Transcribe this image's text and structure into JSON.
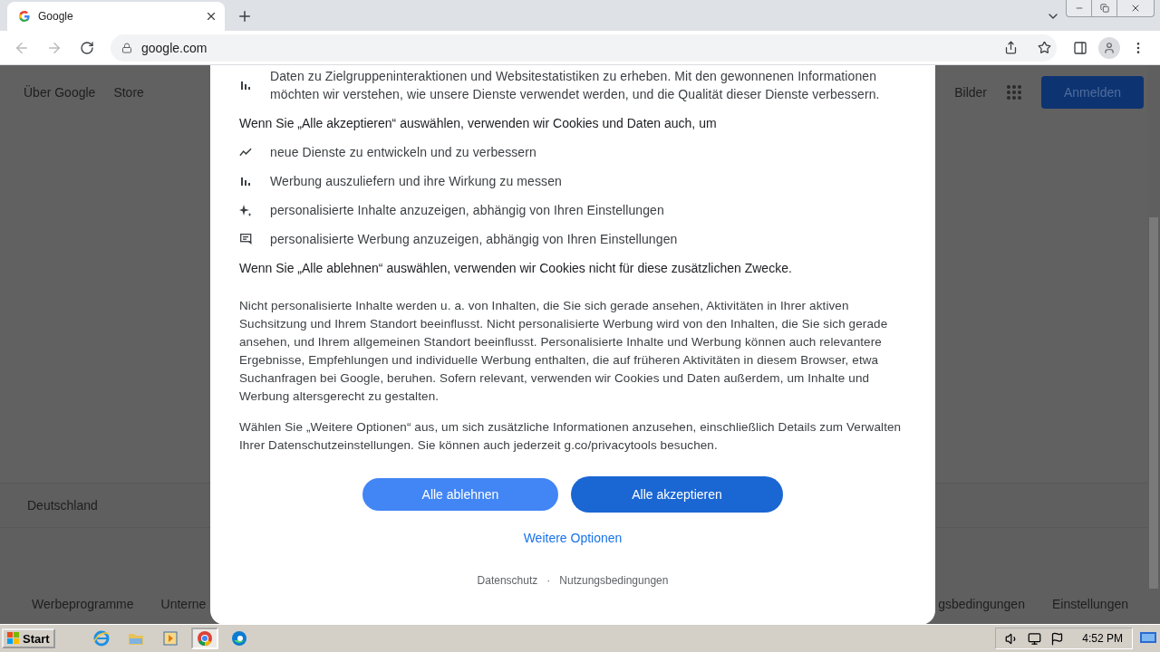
{
  "browser": {
    "tab": {
      "title": "Google"
    },
    "url": "google.com"
  },
  "page": {
    "header_left": [
      "Über Google",
      "Store"
    ],
    "images_link": "Bilder",
    "sign_in": "Anmelden",
    "country": "Deutschland",
    "footer_left": [
      "Werbeprogramme",
      "Unterne"
    ],
    "footer_right": [
      "gsbedingungen",
      "Einstellungen"
    ]
  },
  "dialog": {
    "intro_items": [
      {
        "kind": "bars",
        "text": "Daten zu Zielgruppeninteraktionen und Websitestatistiken zu erheben. Mit den gewonnenen Informationen möchten wir verstehen, wie unsere Dienste verwendet werden, und die Qualität dieser Dienste verbessern."
      }
    ],
    "accept_heading": "Wenn Sie „Alle akzeptieren“ auswählen, verwenden wir Cookies und Daten auch, um",
    "accept_items": [
      {
        "kind": "trend",
        "text": "neue Dienste zu entwickeln und zu verbessern"
      },
      {
        "kind": "bars",
        "text": "Werbung auszuliefern und ihre Wirkung zu messen"
      },
      {
        "kind": "sparkle",
        "text": "personalisierte Inhalte anzuzeigen, abhängig von Ihren Einstellungen"
      },
      {
        "kind": "ad",
        "text": "personalisierte Werbung anzuzeigen, abhängig von Ihren Einstellungen"
      }
    ],
    "reject_note": "Wenn Sie „Alle ablehnen“ auswählen, verwenden wir Cookies nicht für diese zusätzlichen Zwecke.",
    "paragraphs": [
      "Nicht personalisierte Inhalte werden u. a. von Inhalten, die Sie sich gerade ansehen, Aktivitäten in Ihrer aktiven Suchsitzung und Ihrem Standort beeinflusst. Nicht personalisierte Werbung wird von den Inhalten, die Sie sich gerade ansehen, und Ihrem allgemeinen Standort beeinflusst. Personalisierte Inhalte und Werbung können auch relevantere Ergebnisse, Empfehlungen und individuelle Werbung enthalten, die auf früheren Aktivitäten in diesem Browser, etwa Suchanfragen bei Google, beruhen. Sofern relevant, verwenden wir Cookies und Daten außerdem, um Inhalte und Werbung altersgerecht zu gestalten.",
      "Wählen Sie „Weitere Optionen“ aus, um sich zusätzliche Informationen anzusehen, einschließlich Details zum Verwalten Ihrer Datenschutzeinstellungen. Sie können auch jederzeit g.co/privacytools besuchen."
    ],
    "buttons": [
      {
        "label": "Alle ablehnen",
        "kind": "secondary"
      },
      {
        "label": "Alle akzeptieren",
        "kind": "primary"
      }
    ],
    "more_options": "Weitere Optionen",
    "links": [
      "Datenschutz",
      "·",
      "Nutzungsbedingungen"
    ]
  },
  "taskbar": {
    "start": "Start",
    "apps": [
      {
        "kind": "ie",
        "selected": false
      },
      {
        "kind": "folder",
        "selected": false
      },
      {
        "kind": "media",
        "selected": false
      },
      {
        "kind": "chrome",
        "selected": true
      },
      {
        "kind": "edge",
        "selected": false
      }
    ],
    "clock": "4:52 PM"
  }
}
